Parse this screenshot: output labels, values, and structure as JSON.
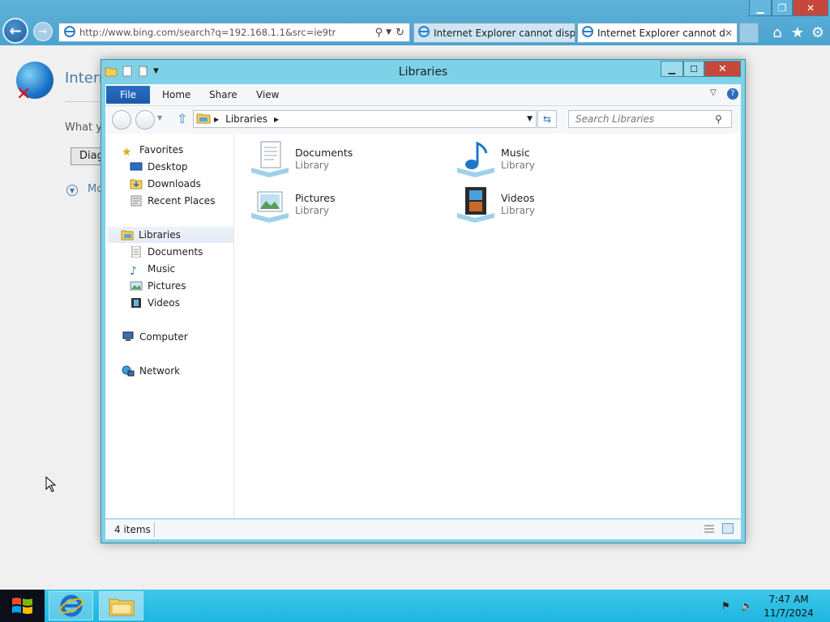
{
  "browser": {
    "address_url": "http://www.bing.com/search?q=192.168.1.1&src=ie9tr",
    "tabs": [
      {
        "label": "Internet Explorer cannot displa...",
        "active": false
      },
      {
        "label": "Internet Explorer cannot dis...",
        "active": true,
        "close": "✕"
      }
    ],
    "page": {
      "title": "Intern",
      "question": "What y",
      "diagnose_label": "Diag",
      "more_label": "Mo"
    }
  },
  "explorer": {
    "title": "Libraries",
    "ribbon_tabs": [
      "File",
      "Home",
      "Share",
      "View"
    ],
    "breadcrumb": "Libraries",
    "search_placeholder": "Search Libraries",
    "nav_pane": {
      "favorites": {
        "label": "Favorites",
        "items": [
          "Desktop",
          "Downloads",
          "Recent Places"
        ]
      },
      "libraries": {
        "label": "Libraries",
        "items": [
          "Documents",
          "Music",
          "Pictures",
          "Videos"
        ]
      },
      "computer": "Computer",
      "network": "Network"
    },
    "items": [
      {
        "name": "Documents",
        "type": "Library",
        "icon": "documents-library-icon"
      },
      {
        "name": "Music",
        "type": "Library",
        "icon": "music-library-icon"
      },
      {
        "name": "Pictures",
        "type": "Library",
        "icon": "pictures-library-icon"
      },
      {
        "name": "Videos",
        "type": "Library",
        "icon": "videos-library-icon"
      }
    ],
    "status": "4 items"
  },
  "taskbar": {
    "time": "7:47 AM",
    "date": "11/7/2024"
  },
  "colors": {
    "title_bar": "#7ed2e8",
    "close_button": "#c7473a",
    "file_tab": "#1b5aa8",
    "taskbar": "#1fb6df"
  }
}
